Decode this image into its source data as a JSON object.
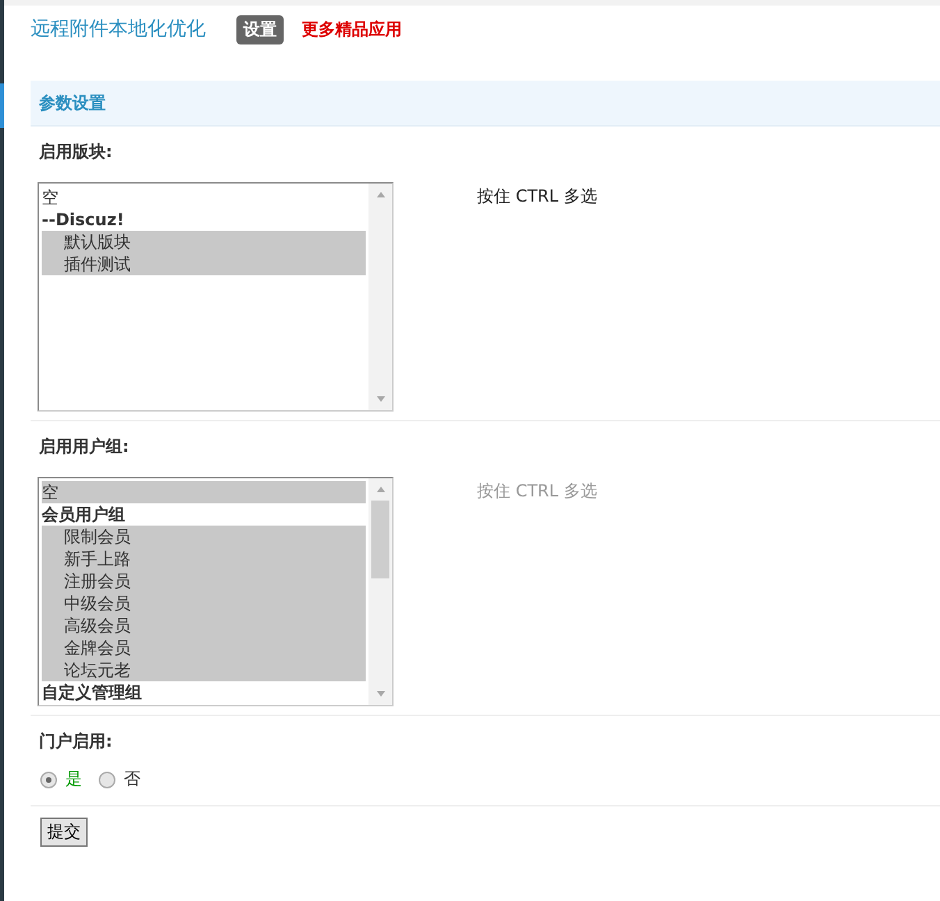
{
  "header": {
    "title": "远程附件本地化优化",
    "tabs": [
      {
        "label": "设置",
        "selected": true
      },
      {
        "label": "更多精品应用",
        "selected": false
      }
    ]
  },
  "section": {
    "title": "参数设置"
  },
  "settings": [
    {
      "kind": "listbox",
      "label": "启用版块:",
      "hint": "按住 CTRL 多选",
      "hint_dimmed": false,
      "scrolled": false,
      "options": [
        {
          "label": "空",
          "selected": false
        },
        {
          "label": "--Discuz!",
          "group": true,
          "selected": false,
          "children": [
            {
              "label": "默认版块",
              "selected": true
            },
            {
              "label": "插件测试",
              "selected": true
            }
          ]
        }
      ]
    },
    {
      "kind": "listbox",
      "label": "启用用户组:",
      "hint": "按住 CTRL 多选",
      "hint_dimmed": true,
      "scrolled": true,
      "options": [
        {
          "label": "空",
          "selected": true
        },
        {
          "label": "会员用户组",
          "group": true,
          "selected": false,
          "children": [
            {
              "label": "限制会员",
              "selected": true
            },
            {
              "label": "新手上路",
              "selected": true
            },
            {
              "label": "注册会员",
              "selected": true
            },
            {
              "label": "中级会员",
              "selected": true
            },
            {
              "label": "高级会员",
              "selected": true
            },
            {
              "label": "金牌会员",
              "selected": true
            },
            {
              "label": "论坛元老",
              "selected": true
            }
          ]
        },
        {
          "label": "自定义管理组",
          "group": true,
          "selected": false
        }
      ]
    },
    {
      "kind": "radio",
      "label": "门户启用:",
      "choices": [
        {
          "label": "是",
          "selected": true
        },
        {
          "label": "否",
          "selected": false
        }
      ]
    }
  ],
  "submit": "提交"
}
